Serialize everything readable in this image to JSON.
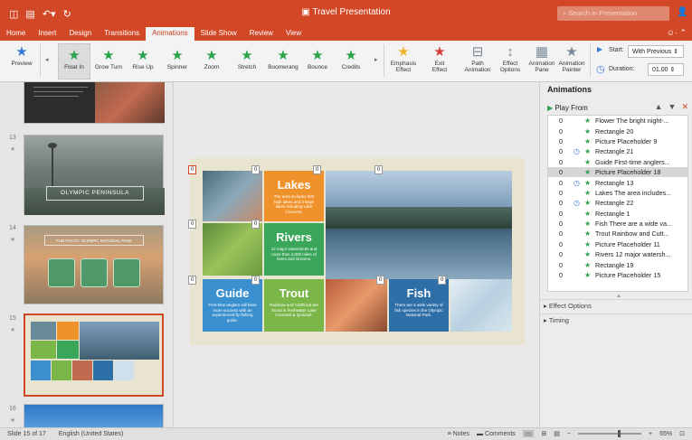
{
  "app": {
    "title": "Travel Presentation",
    "search_placeholder": "Search in Presentation",
    "title_icons": [
      "sidebar-icon",
      "save-icon",
      "undo-icon",
      "redo-icon"
    ]
  },
  "tabs": [
    "Home",
    "Insert",
    "Design",
    "Transitions",
    "Animations",
    "Slide Show",
    "Review",
    "View"
  ],
  "active_tab": "Animations",
  "ribbon": {
    "preview": "Preview",
    "effects": [
      "Float In",
      "Grow Turn",
      "Rise Up",
      "Spinner",
      "Zoom",
      "Stretch",
      "Boomerang",
      "Bounce",
      "Credits"
    ],
    "selected_effect": "Float In",
    "groups": [
      {
        "l1": "Emphasis",
        "l2": "Effect"
      },
      {
        "l1": "Exit",
        "l2": "Effect"
      },
      {
        "l1": "Path",
        "l2": "Animation"
      },
      {
        "l1": "Effect",
        "l2": "Options"
      },
      {
        "l1": "Animation",
        "l2": "Pane"
      },
      {
        "l1": "Animation",
        "l2": "Painter"
      }
    ],
    "start_label": "Start:",
    "start_value": "With Previous",
    "duration_label": "Duration:",
    "duration_value": "01.00"
  },
  "thumbnails": [
    {
      "num": "13",
      "caption": "OLYMPIC PENINSULA"
    },
    {
      "num": "14",
      "caption": "FUN FACTS: OLYMPIC NATIONAL PARK"
    },
    {
      "num": "15",
      "caption": ""
    },
    {
      "num": "16",
      "caption": ""
    }
  ],
  "slide": {
    "tiles": [
      {
        "title": "Lakes",
        "desc": "The area includes 600 high lakes and 3 large lakes including Lake Crescent."
      },
      {
        "title": "Rivers",
        "desc": "12 major watersheds and more than 4,000 miles of rivers and streams."
      },
      {
        "title": "Guide",
        "desc": "First-time anglers will have more success with an experienced fly-fishing guide."
      },
      {
        "title": "Trout",
        "desc": "Rainbow and Cutthroat are found in freshwater Lake Crescent & Quinault."
      },
      {
        "title": "Fish",
        "desc": "There are a wide variety of fish species in the Olympic National Park."
      }
    ],
    "badge": "0"
  },
  "animations": {
    "title": "Animations",
    "play_from": "Play From",
    "items": [
      {
        "num": "0",
        "clock": false,
        "name": "Flower The bright night-..."
      },
      {
        "num": "0",
        "clock": false,
        "name": "Rectangle 20"
      },
      {
        "num": "0",
        "clock": false,
        "name": "Picture Placeholder 9"
      },
      {
        "num": "0",
        "clock": true,
        "name": "Rectangle 21"
      },
      {
        "num": "0",
        "clock": false,
        "name": "Guide First-time anglers..."
      },
      {
        "num": "0",
        "clock": false,
        "name": "Picture Placeholder 18",
        "selected": true
      },
      {
        "num": "0",
        "clock": true,
        "name": "Rectangle 13"
      },
      {
        "num": "0",
        "clock": false,
        "name": "Lakes The area includes..."
      },
      {
        "num": "0",
        "clock": true,
        "name": "Rectangle 22"
      },
      {
        "num": "0",
        "clock": false,
        "name": "Rectangle 1"
      },
      {
        "num": "0",
        "clock": false,
        "name": "Fish There are a wide va..."
      },
      {
        "num": "0",
        "clock": false,
        "name": "Trout Rainbow and Cutt..."
      },
      {
        "num": "0",
        "clock": false,
        "name": "Picture Placeholder 11"
      },
      {
        "num": "0",
        "clock": false,
        "name": "Rivers 12 major watersh..."
      },
      {
        "num": "0",
        "clock": false,
        "name": "Rectangle 19"
      },
      {
        "num": "0",
        "clock": false,
        "name": "Picture Placeholder 15"
      }
    ],
    "effect_options": "Effect Options",
    "timing": "Timing"
  },
  "status": {
    "slide": "Slide 15 of 17",
    "language": "English (United States)",
    "notes": "Notes",
    "comments": "Comments",
    "zoom": "65%",
    "zoom_fraction": 0.65
  },
  "colors": {
    "brand": "#d24726",
    "orange_tile": "#f0922b",
    "green_tile": "#3aa65a",
    "blue_tile": "#3a8fcf",
    "lime_tile": "#7ab648"
  }
}
